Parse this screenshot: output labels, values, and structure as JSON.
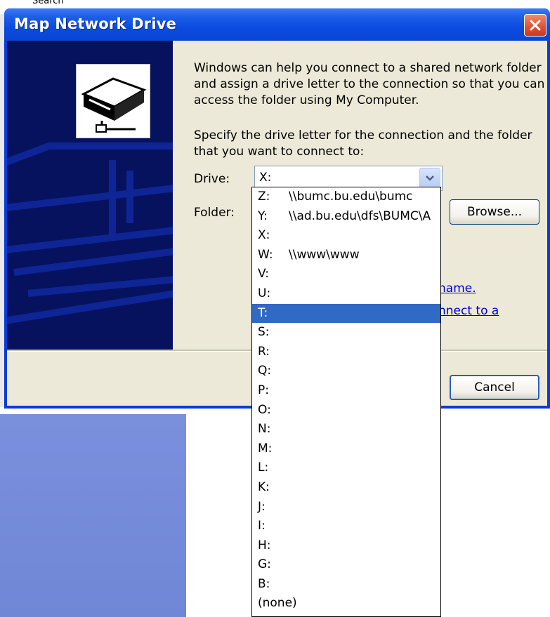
{
  "background": {
    "top_text": "Search"
  },
  "dialog": {
    "title": "Map Network Drive",
    "intro": "Windows can help you connect to a shared network folder and assign a drive letter to the connection so that you can access the folder using My Computer.",
    "specify": "Specify the drive letter for the connection and the folder that you want to connect to:",
    "drive_label": "Drive:",
    "drive_value": "X:",
    "folder_label": "Folder:",
    "browse_label": "Browse...",
    "cancel_label": "Cancel",
    "link1_text": "name.",
    "link2_text": "nnect to a"
  },
  "drive_options": [
    {
      "letter": "Z:",
      "path": "\\\\bumc.bu.edu\\bumc"
    },
    {
      "letter": "Y:",
      "path": "\\\\ad.bu.edu\\dfs\\BUMC\\A"
    },
    {
      "letter": "X:",
      "path": ""
    },
    {
      "letter": "W:",
      "path": "\\\\www\\www"
    },
    {
      "letter": "V:",
      "path": ""
    },
    {
      "letter": "U:",
      "path": ""
    },
    {
      "letter": "T:",
      "path": "",
      "selected": true
    },
    {
      "letter": "S:",
      "path": ""
    },
    {
      "letter": "R:",
      "path": ""
    },
    {
      "letter": "Q:",
      "path": ""
    },
    {
      "letter": "P:",
      "path": ""
    },
    {
      "letter": "O:",
      "path": ""
    },
    {
      "letter": "N:",
      "path": ""
    },
    {
      "letter": "M:",
      "path": ""
    },
    {
      "letter": "L:",
      "path": ""
    },
    {
      "letter": "K:",
      "path": ""
    },
    {
      "letter": "J:",
      "path": ""
    },
    {
      "letter": "I:",
      "path": ""
    },
    {
      "letter": "H:",
      "path": ""
    },
    {
      "letter": "G:",
      "path": ""
    },
    {
      "letter": "B:",
      "path": ""
    },
    {
      "letter": "(none)",
      "path": ""
    }
  ],
  "colors": {
    "titlebar": "#0a45d0",
    "selection": "#316ac5",
    "dialog_face": "#ece9d8",
    "art_background": "#06125e"
  },
  "icons": [
    "close-icon",
    "network-drive-icon",
    "chevron-down-icon"
  ]
}
